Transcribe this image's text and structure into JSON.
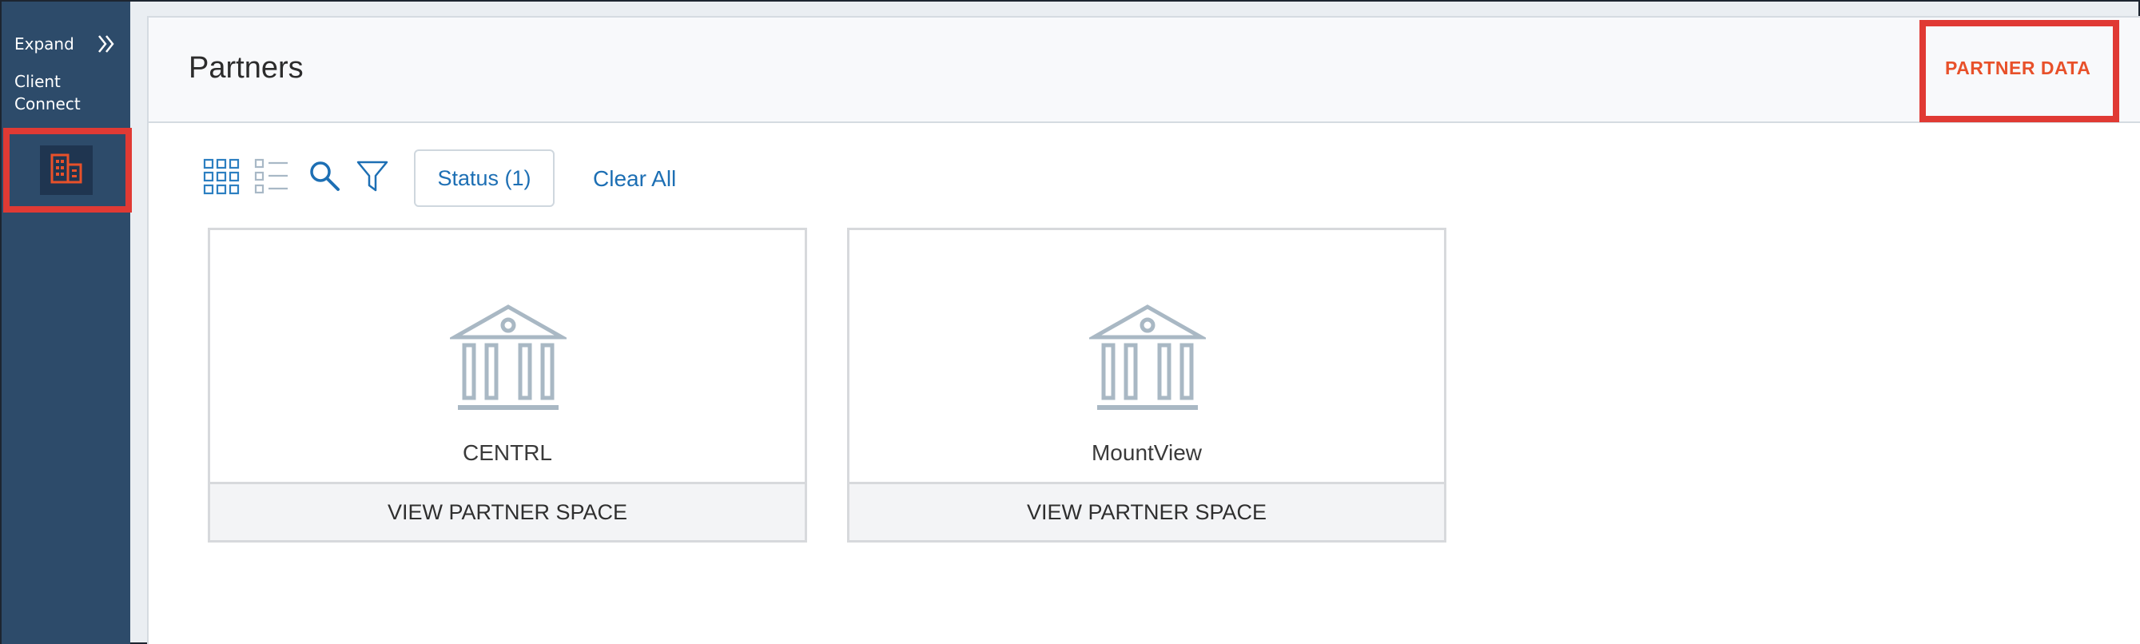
{
  "sidebar": {
    "expand_label": "Expand",
    "expand_icon": "double-chevron-right-icon",
    "section_label": "Client\nConnect",
    "nav_icon": "building-icon",
    "colors": {
      "background": "#2d4b6a",
      "active_tile": "#1f3550",
      "icon": "#e8512a",
      "highlight": "#e03a34"
    }
  },
  "header": {
    "title": "Partners",
    "partner_data_label": "PARTNER DATA"
  },
  "toolbar": {
    "grid_view_icon": "grid-view-icon",
    "list_view_icon": "list-view-icon",
    "search_icon": "search-icon",
    "filter_icon": "filter-icon",
    "status_filter_label": "Status (1)",
    "clear_all_label": "Clear All"
  },
  "cards": [
    {
      "name": "CENTRL",
      "icon": "bank-icon",
      "action_label": "VIEW PARTNER SPACE"
    },
    {
      "name": "MountView",
      "icon": "bank-icon",
      "action_label": "VIEW PARTNER SPACE"
    }
  ]
}
